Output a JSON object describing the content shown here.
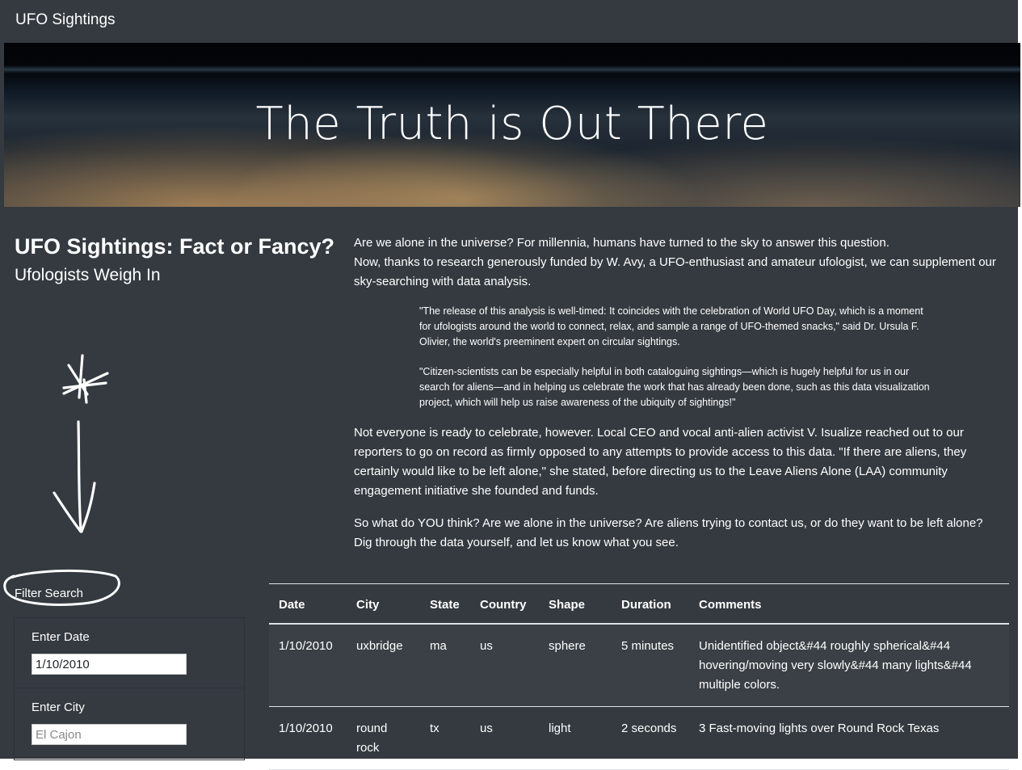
{
  "navbar": {
    "brand": "UFO Sightings"
  },
  "hero": {
    "title": "The Truth is Out There"
  },
  "left": {
    "title": "UFO Sightings: Fact or Fancy?",
    "subtitle": "Ufologists Weigh In"
  },
  "filter": {
    "label": "Filter Search",
    "date_label": "Enter Date",
    "date_value": "1/10/2010",
    "city_label": "Enter City",
    "city_placeholder": "El Cajon"
  },
  "article": {
    "intro_1": "Are we alone in the universe? For millennia, humans have turned to the sky to answer this question.",
    "intro_2": "Now, thanks to research generously funded by W. Avy, a UFO-enthusiast and amateur ufologist, we can supplement our sky-searching with data analysis.",
    "quote_1": "\"The release of this analysis is well-timed: It coincides with the celebration of World UFO Day, which is a moment for ufologists around the world to connect, relax, and sample a range of UFO-themed snacks,\" said Dr. Ursula F. Olivier, the world's preeminent expert on circular sightings.",
    "quote_2": "\"Citizen-scientists can be especially helpful in both cataloguing sightings—which is hugely helpful for us in our search for aliens—and in helping us celebrate the work that has already been done, such as this data visualization project, which will help us raise awareness of the ubiquity of sightings!\"",
    "para_3": "Not everyone is ready to celebrate, however. Local CEO and vocal anti-alien activist V. Isualize reached out to our reporters to go on record as firmly opposed to any attempts to provide access to this data. \"If there are aliens, they certainly would like to be left alone,\" she stated, before directing us to the Leave Aliens Alone (LAA) community engagement initiative she founded and funds.",
    "para_4a": "So what do YOU think? Are we alone in the universe? Are aliens trying to contact us, or do they want to be left alone?",
    "para_4b": "Dig through the data yourself, and let us know what you see."
  },
  "table": {
    "headers": [
      "Date",
      "City",
      "State",
      "Country",
      "Shape",
      "Duration",
      "Comments"
    ],
    "rows": [
      [
        "1/10/2010",
        "uxbridge",
        "ma",
        "us",
        "sphere",
        "5 minutes",
        "Unidentified object&#44 roughly spherical&#44 hovering/moving very slowly&#44 many lights&#44 multiple colors."
      ],
      [
        "1/10/2010",
        "round rock",
        "tx",
        "us",
        "light",
        "2 seconds",
        "3 Fast-moving lights over Round Rock Texas"
      ]
    ]
  }
}
